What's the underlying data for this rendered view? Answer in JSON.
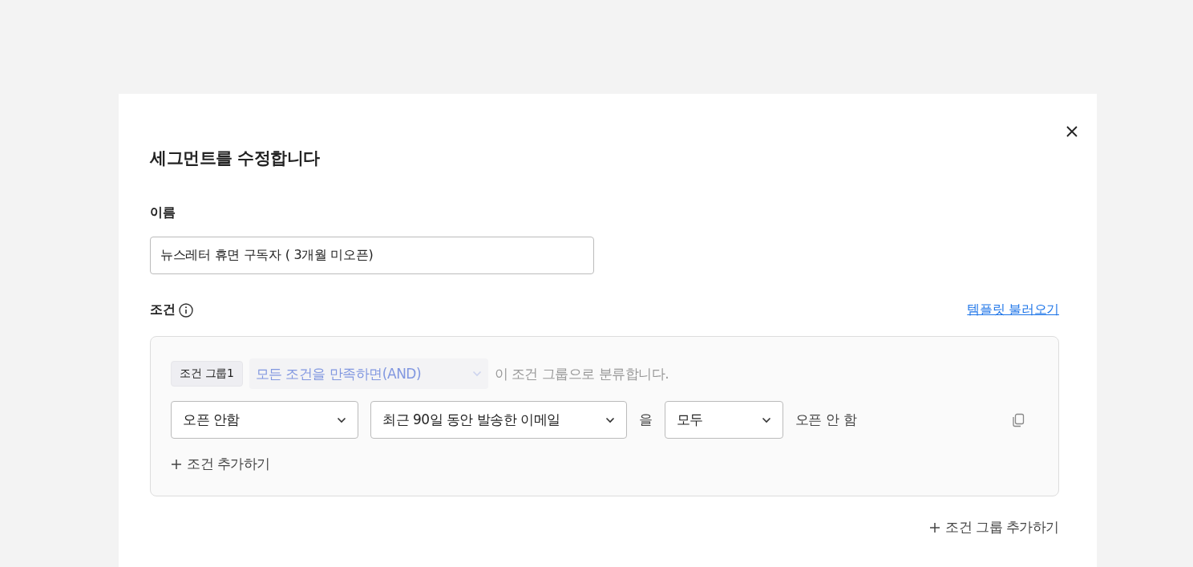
{
  "dialog": {
    "title": "세그먼트를 수정합니다"
  },
  "name_field": {
    "label": "이름",
    "value": "뉴스레터 휴면 구독자 ( 3개월 미오픈)"
  },
  "conditions": {
    "label": "조건",
    "template_link": "템플릿 불러오기"
  },
  "group": {
    "badge": "조건 그룹1",
    "match_select": {
      "value": "모든 조건을 만족하면(AND)",
      "disabled": true
    },
    "suffix": "이 조건 그룹으로 분류합니다.",
    "rows": [
      {
        "selects": [
          "오픈 안함",
          "최근 90일 동안 발송한 이메일"
        ],
        "particle": "을",
        "scope": "모두",
        "result": "오픈 안 함"
      }
    ],
    "add_condition": "조건 추가하기"
  },
  "add_group": "조건 그룹 추가하기"
}
